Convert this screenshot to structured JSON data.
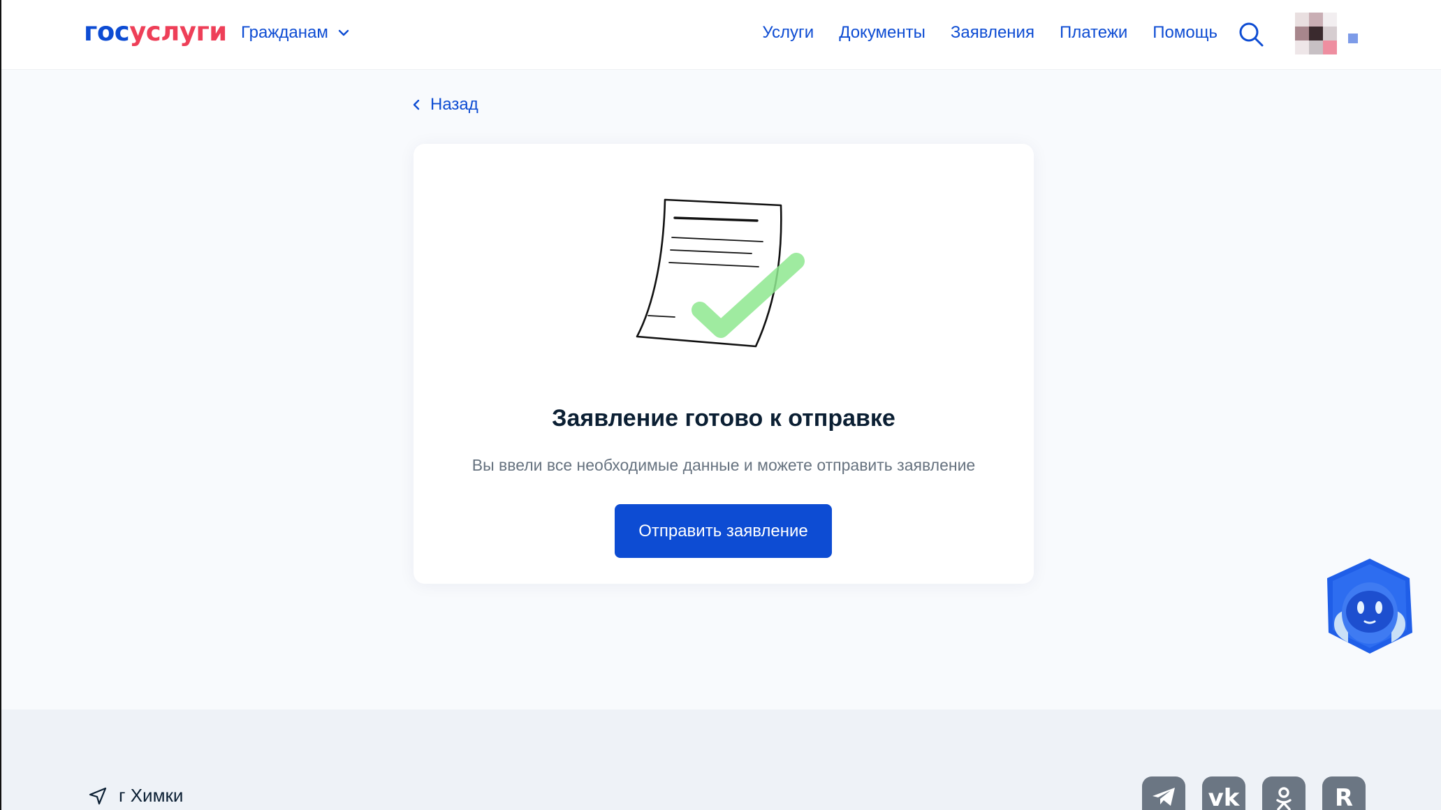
{
  "header": {
    "logo_part1": "гос",
    "logo_part2": "услуги",
    "role_label": "Гражданам",
    "nav": [
      "Услуги",
      "Документы",
      "Заявления",
      "Платежи",
      "Помощь"
    ]
  },
  "back_label": "Назад",
  "card": {
    "title": "Заявление готово к отправке",
    "text": "Вы ввели все необходимые данные и можете отправить заявление",
    "submit_label": "Отправить заявление"
  },
  "footer": {
    "location": "г Химки",
    "socials": [
      "telegram-icon",
      "vk-icon",
      "odnoklassniki-icon",
      "rutube-icon"
    ]
  },
  "colors": {
    "primary": "#0d4cd3",
    "brand_red": "#ee3f58",
    "text_dark": "#0b1f33",
    "text_muted": "#66727f",
    "check_green": "#6be07a"
  }
}
